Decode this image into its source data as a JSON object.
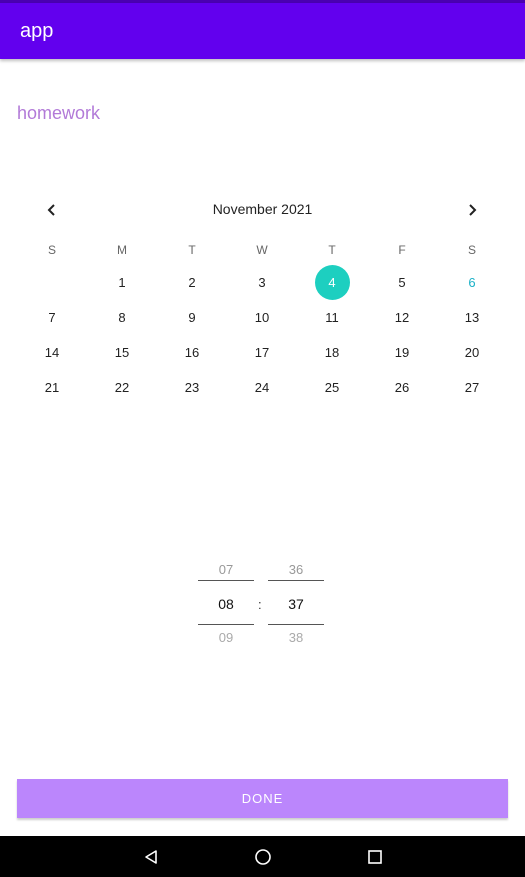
{
  "app": {
    "title": "app"
  },
  "task": {
    "name": "homework"
  },
  "calendar": {
    "month_label": "November 2021",
    "prev_icon": "chevron-left-icon",
    "next_icon": "chevron-right-icon",
    "weekdays": [
      "S",
      "M",
      "T",
      "W",
      "T",
      "F",
      "S"
    ],
    "weeks": [
      [
        "",
        "1",
        "2",
        "3",
        "4",
        "5",
        "6"
      ],
      [
        "7",
        "8",
        "9",
        "10",
        "11",
        "12",
        "13"
      ],
      [
        "14",
        "15",
        "16",
        "17",
        "18",
        "19",
        "20"
      ],
      [
        "21",
        "22",
        "23",
        "24",
        "25",
        "26",
        "27"
      ]
    ],
    "selected_day": "4",
    "highlighted_day": "6",
    "colors": {
      "selected_bg": "#1dcfc0",
      "highlight_text": "#1ab1c7"
    }
  },
  "time_picker": {
    "hour": {
      "prev": "07",
      "current": "08",
      "next": "09"
    },
    "separator": ":",
    "minute": {
      "prev": "36",
      "current": "37",
      "next": "38"
    }
  },
  "done_button": {
    "label": "DONE"
  },
  "system_nav": {
    "back_icon": "back-icon",
    "home_icon": "home-icon",
    "recents_icon": "recents-icon"
  },
  "colors": {
    "app_bar": "#6200ee",
    "accent_button": "#bb86fc",
    "task_text": "#b27ad8"
  }
}
